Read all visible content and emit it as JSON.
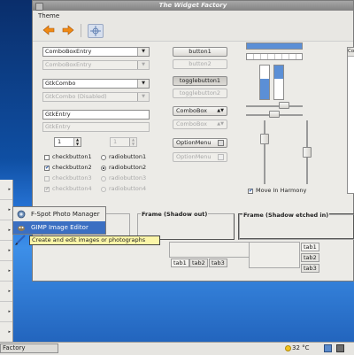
{
  "window": {
    "title": "The Widget Factory",
    "menu": [
      "Theme"
    ]
  },
  "combos": [
    {
      "label": "ComboBoxEntry",
      "disabled": false
    },
    {
      "label": "ComboBoxEntry",
      "disabled": true
    },
    {
      "label": "GtkCombo",
      "disabled": false
    },
    {
      "label": "GtkCombo (Disabled)",
      "disabled": true
    }
  ],
  "entries": [
    {
      "label": "GtkEntry",
      "disabled": false
    },
    {
      "label": "GtkEntry",
      "disabled": true
    }
  ],
  "spinbuttons": [
    {
      "value": "1",
      "disabled": false
    },
    {
      "value": "1",
      "disabled": true
    }
  ],
  "checkbuttons": [
    {
      "label": "checkbutton1",
      "checked": false,
      "disabled": false
    },
    {
      "label": "checkbutton2",
      "checked": true,
      "disabled": false
    },
    {
      "label": "checkbutton3",
      "checked": false,
      "disabled": true
    },
    {
      "label": "checkbutton4",
      "checked": true,
      "disabled": true
    }
  ],
  "radiobuttons": [
    {
      "label": "radiobutton1",
      "checked": false,
      "disabled": false
    },
    {
      "label": "radiobutton2",
      "checked": true,
      "disabled": false
    },
    {
      "label": "radiobutton3",
      "checked": false,
      "disabled": true
    },
    {
      "label": "radiobutton4",
      "checked": true,
      "disabled": true
    }
  ],
  "buttons": {
    "button1": "button1",
    "button2": "button2",
    "toggle1": "togglebutton1",
    "toggle2": "togglebutton2",
    "combobox1": "ComboBox",
    "combobox2": "ComboBox",
    "optionmenu1": "OptionMenu",
    "optionmenu2": "OptionMenu"
  },
  "sliders": {
    "move_in_harmony_label": "Move In Harmony",
    "move_in_harmony_checked": true
  },
  "frames": {
    "frame_mid": "Frame (Shadow out)",
    "frame_right": "Frame (Shadow etched in)"
  },
  "tabs": {
    "bottom": [
      "tab1",
      "tab2",
      "tab3"
    ],
    "right": [
      "tab1",
      "tab2",
      "tab3"
    ]
  },
  "list_header": "Co",
  "menu": {
    "items": [
      {
        "label": "F-Spot Photo Manager",
        "selected": false
      },
      {
        "label": "GIMP Image Editor",
        "selected": true
      }
    ],
    "tooltip": "Create and edit images or photographs"
  },
  "taskbar": {
    "app_label": "Factory",
    "temperature": "32 °C"
  },
  "colors": {
    "accent": "#3b6fc2",
    "progress": "#5b8fd6",
    "tooltip_bg": "#fbf5a8"
  }
}
